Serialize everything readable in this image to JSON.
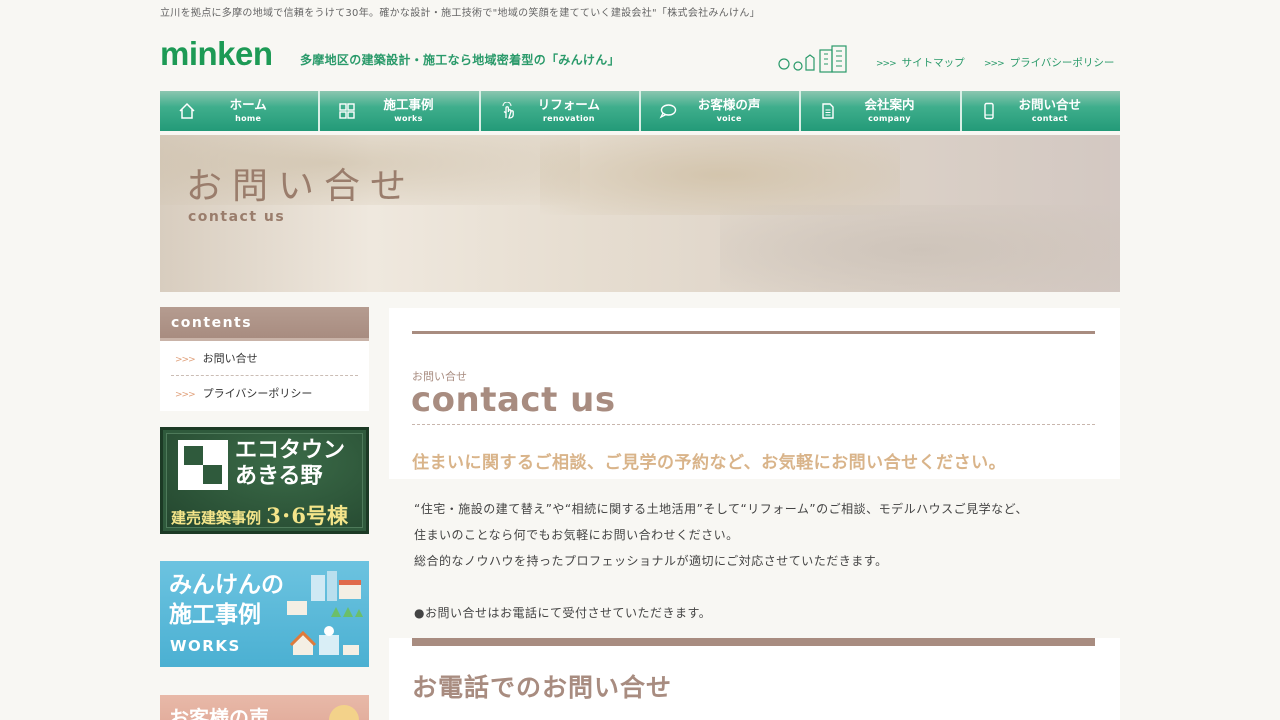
{
  "tagline": "立川を拠点に多摩の地域で信頼をうけて30年。確かな設計・施工技術で\"地域の笑顔を建てていく建設会社\"「株式会社みんけん」",
  "header": {
    "logo": "minken",
    "catch": "多摩地区の建築設計・施工なら地域密着型の「みんけん」",
    "links": [
      {
        "label": "サイトマップ",
        "arrow": ">>>"
      },
      {
        "label": "プライバシーポリシー",
        "arrow": ">>>"
      }
    ]
  },
  "nav": [
    {
      "ja": "ホーム",
      "en": "home",
      "icon": "home-icon"
    },
    {
      "ja": "施工事例",
      "en": "works",
      "icon": "grid-icon"
    },
    {
      "ja": "リフォーム",
      "en": "renovation",
      "icon": "hand-icon"
    },
    {
      "ja": "お客様の声",
      "en": "voice",
      "icon": "chat-icon"
    },
    {
      "ja": "会社案内",
      "en": "company",
      "icon": "document-icon"
    },
    {
      "ja": "お問い合せ",
      "en": "contact",
      "icon": "phone-icon"
    }
  ],
  "hero": {
    "title": "お問い合せ",
    "subtitle": "contact us"
  },
  "sidebar": {
    "heading": "contents",
    "arrow": ">>>",
    "items": [
      "お問い合せ",
      "プライバシーポリシー"
    ],
    "banners": {
      "ecotown": {
        "line1": "エコタウン",
        "line2": "あきる野",
        "line3a": "建売建築事例 ",
        "line3b": "3･6号棟"
      },
      "works": {
        "line1": "みんけんの",
        "line2": "施工事例",
        "line3": "WORKS"
      },
      "voice": {
        "line1": "お客様の声"
      }
    }
  },
  "main": {
    "heading_small": "お問い合せ",
    "heading_big": "contact us",
    "lead": "住まいに関するご相談、ご見学の予約など、お気軽にお問い合せください。",
    "paragraphs": [
      "“住宅・施設の建て替え”や“相続に関する土地活用”そして“リフォーム”のご相談、モデルハウスご見学など、",
      "住まいのことなら何でもお気軽にお問い合わせください。",
      "総合的なノウハウを持ったプロフェッショナルが適切にご対応させていただきます。",
      "",
      "●お問い合せはお電話にて受付させていただきます。"
    ],
    "tel_heading": "お電話でのお問い合せ"
  },
  "colors": {
    "brand_green": "#1d9a55",
    "nav_green": "#239a78",
    "accent_brown": "#a88c80",
    "lead_gold": "#d9b48a"
  }
}
